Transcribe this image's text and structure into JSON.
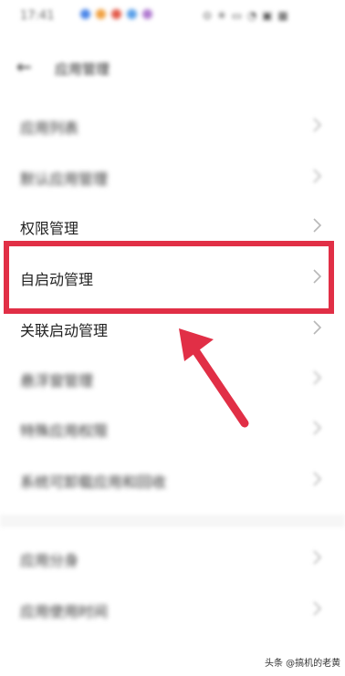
{
  "status_bar": {
    "time": "17:41",
    "notification_dots": [
      "#4b86e8",
      "#f0a040",
      "#e25a4a",
      "#5aa0e8",
      "#b07ad0"
    ],
    "right_icons": "⊙ ✳ ▭ ◔ ▣ ▦"
  },
  "header": {
    "back_icon": "←",
    "title": "应用管理"
  },
  "menu": [
    {
      "label": "应用列表",
      "blurred": true
    },
    {
      "label": "默认应用管理",
      "blurred": true
    },
    {
      "label": "权限管理",
      "blurred": false
    },
    {
      "label": "自启动管理",
      "blurred": false,
      "highlighted": true
    },
    {
      "label": "关联启动管理",
      "blurred": false
    },
    {
      "label": "悬浮窗管理",
      "blurred": true
    },
    {
      "label": "特殊应用权限",
      "blurred": true
    },
    {
      "label": "系统可卸载应用和回收",
      "blurred": true
    },
    {
      "label": "应用分身",
      "blurred": true
    },
    {
      "label": "应用使用时间",
      "blurred": true
    }
  ],
  "annotation": {
    "highlight_color": "#e12f46",
    "arrow_color": "#e12f46"
  },
  "watermark": "头条 @搞机的老黄"
}
